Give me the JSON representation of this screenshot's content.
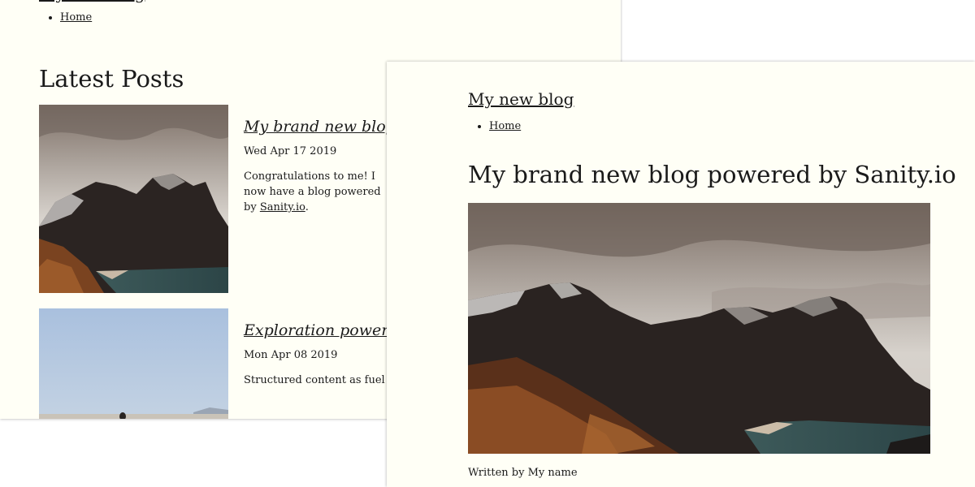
{
  "site": {
    "title": "My new blog",
    "nav": [
      "Home"
    ]
  },
  "list_page": {
    "heading": "Latest Posts",
    "posts": [
      {
        "title": "My brand new blog powered by Sanity.io",
        "date": "Wed Apr 17 2019",
        "excerpt_start": "Congratulations to me! I now have a blog powered by ",
        "excerpt_link": "Sanity.io",
        "excerpt_end": ".",
        "image": "mountain-landscape-image"
      },
      {
        "title": "Exploration powered by structured content",
        "date": "Mon Apr 08 2019",
        "excerpt": "Structured content as fuel for exploration",
        "image": "sky-beach-image"
      }
    ]
  },
  "post_page": {
    "title": "My brand new blog powered by Sanity.io",
    "byline": "Written by My name",
    "image": "mountain-landscape-image"
  },
  "colors": {
    "page_background": "#fffff6",
    "text": "#1a1a1a"
  }
}
